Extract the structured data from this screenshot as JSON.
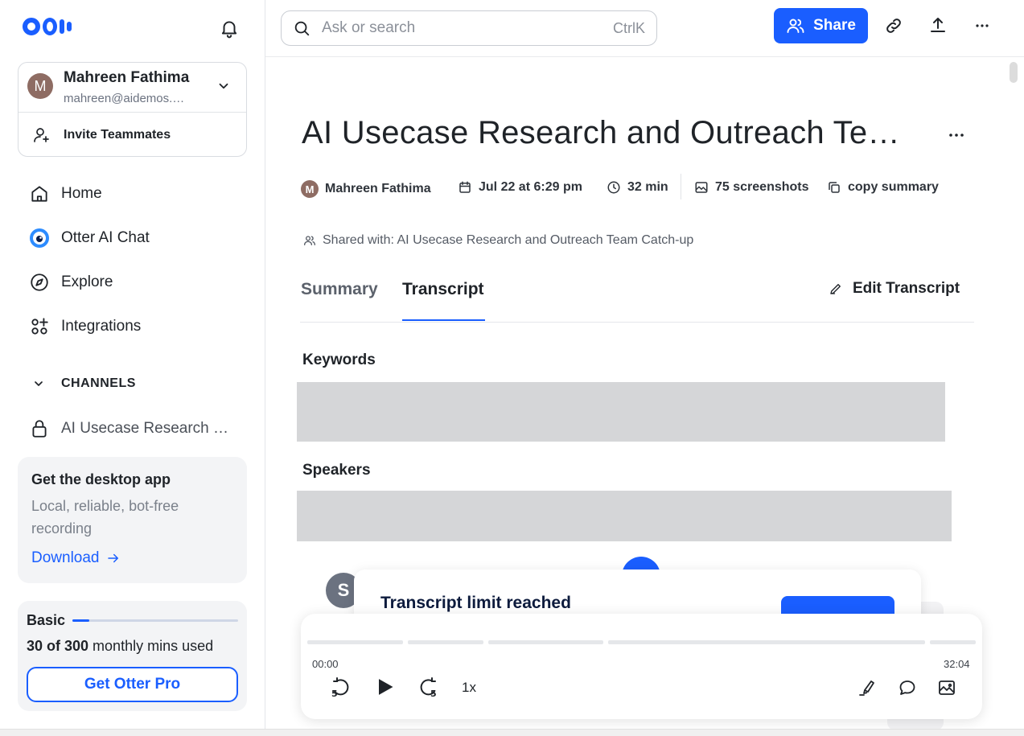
{
  "app": {
    "brand": "Otter",
    "accent": "#1a5eff"
  },
  "user": {
    "initial": "M",
    "name": "Mahreen Fathima",
    "email": "mahreen@aidemos.…"
  },
  "sidebar": {
    "invite": "Invite Teammates",
    "nav": [
      {
        "label": "Home",
        "icon": "home-icon"
      },
      {
        "label": "Otter AI Chat",
        "icon": "otter-chat-icon"
      },
      {
        "label": "Explore",
        "icon": "compass-icon"
      },
      {
        "label": "Integrations",
        "icon": "apps-plus-icon"
      }
    ],
    "channels_heading": "CHANNELS",
    "channels": [
      {
        "label": "AI Usecase Research …",
        "icon": "lock-icon"
      }
    ],
    "promo": {
      "title": "Get the desktop app",
      "subtitle": "Local, reliable, bot-free recording",
      "link": "Download"
    },
    "plan": {
      "name": "Basic",
      "used_bold": "30 of 300",
      "used_rest": " monthly mins used",
      "used_fraction": 0.1,
      "button": "Get Otter Pro"
    }
  },
  "topbar": {
    "search_placeholder": "Ask or search",
    "search_shortcut": "CtrlK",
    "share": "Share"
  },
  "conversation": {
    "title": "AI Usecase Research and Outreach Te…",
    "meta": {
      "owner": "Mahreen Fathima",
      "date": "Jul 22 at 6:29 pm",
      "duration": "32 min",
      "screenshots": "75 screenshots",
      "copy": "copy summary"
    },
    "shared_with": "Shared with: AI Usecase Research and Outreach Team Catch-up",
    "tabs": [
      "Summary",
      "Transcript"
    ],
    "active_tab": "Transcript",
    "edit": "Edit Transcript",
    "keywords_heading": "Keywords",
    "speakers_heading": "Speakers",
    "speaker_initial": "S"
  },
  "limit": {
    "title": "Transcript limit reached"
  },
  "player": {
    "current": "00:00",
    "total": "32:04",
    "speed": "1x",
    "skip_back": "5",
    "skip_forward": "5"
  }
}
